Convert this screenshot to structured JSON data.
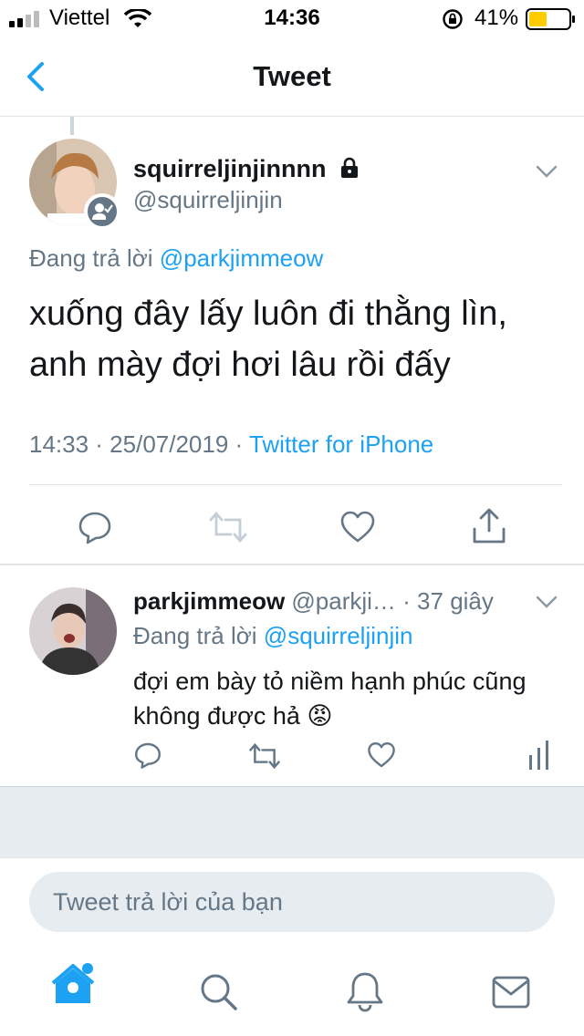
{
  "status_bar": {
    "carrier": "Viettel",
    "time": "14:36",
    "battery": "41%"
  },
  "nav": {
    "title": "Tweet",
    "back_icon": "chevron-left-icon"
  },
  "main_tweet": {
    "display_name": "squirreljinjinnnn",
    "handle": "@squirreljinjin",
    "replying_prefix": "Đang trả lời",
    "replying_to": "@parkjimmeow",
    "text": "xuống đây lấy luôn đi thằng lìn, anh mày đợi hơi lâu rồi đấy",
    "timestamp": "14:33 · 25/07/2019 ·",
    "source": "Twitter for iPhone",
    "actions": [
      "reply-icon",
      "retweet-icon",
      "like-icon",
      "share-icon"
    ]
  },
  "reply_tweet": {
    "display_name": "parkjimmeow",
    "handle": "@parkji…",
    "time": "· 37 giây",
    "replying_prefix": "Đang trả lời",
    "replying_to": "@squirreljinjin",
    "text": "đợi em bày tỏ niềm hạnh phúc cũng không được hả 😡",
    "actions": [
      "reply-icon",
      "retweet-icon",
      "like-icon",
      "analytics-icon"
    ]
  },
  "composer": {
    "placeholder": "Tweet trả lời của bạn"
  },
  "tabbar": {
    "items": [
      "home-icon",
      "search-icon",
      "notifications-icon",
      "messages-icon"
    ]
  },
  "colors": {
    "accent": "#1da1f2",
    "secondary_text": "#657786",
    "divider": "#dfe3e6",
    "background_gray": "#e6ecf0"
  }
}
